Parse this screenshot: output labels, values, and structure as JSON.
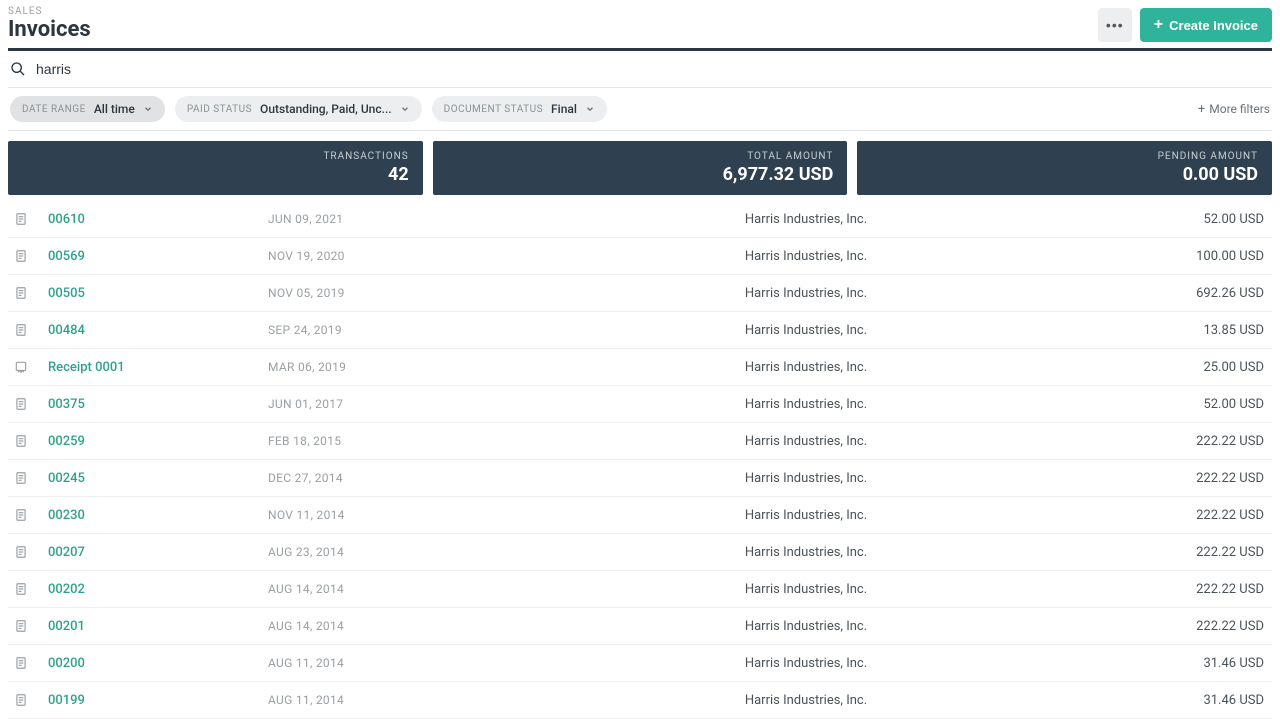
{
  "breadcrumb": "SALES",
  "page_title": "Invoices",
  "create_button": "Create Invoice",
  "search": {
    "value": "harris",
    "placeholder": ""
  },
  "filters": {
    "date_range": {
      "label": "DATE RANGE",
      "value": "All time"
    },
    "paid_status": {
      "label": "PAID STATUS",
      "value": "Outstanding, Paid, Unc..."
    },
    "document_status": {
      "label": "DOCUMENT STATUS",
      "value": "Final"
    },
    "more_filters": "More filters"
  },
  "summary": {
    "transactions": {
      "label": "TRANSACTIONS",
      "value": "42"
    },
    "total_amount": {
      "label": "TOTAL AMOUNT",
      "value": "6,977.32 USD"
    },
    "pending_amount": {
      "label": "PENDING AMOUNT",
      "value": "0.00 USD"
    }
  },
  "invoices": [
    {
      "id": "00610",
      "date": "JUN 09, 2021",
      "company": "Harris Industries, Inc.",
      "amount": "52.00 USD",
      "icon": "doc"
    },
    {
      "id": "00569",
      "date": "NOV 19, 2020",
      "company": "Harris Industries, Inc.",
      "amount": "100.00 USD",
      "icon": "doc"
    },
    {
      "id": "00505",
      "date": "NOV 05, 2019",
      "company": "Harris Industries, Inc.",
      "amount": "692.26 USD",
      "icon": "doc"
    },
    {
      "id": "00484",
      "date": "SEP 24, 2019",
      "company": "Harris Industries, Inc.",
      "amount": "13.85 USD",
      "icon": "doc"
    },
    {
      "id": "Receipt 0001",
      "date": "MAR 06, 2019",
      "company": "Harris Industries, Inc.",
      "amount": "25.00 USD",
      "icon": "receipt"
    },
    {
      "id": "00375",
      "date": "JUN 01, 2017",
      "company": "Harris Industries, Inc.",
      "amount": "52.00 USD",
      "icon": "doc"
    },
    {
      "id": "00259",
      "date": "FEB 18, 2015",
      "company": "Harris Industries, Inc.",
      "amount": "222.22 USD",
      "icon": "doc"
    },
    {
      "id": "00245",
      "date": "DEC 27, 2014",
      "company": "Harris Industries, Inc.",
      "amount": "222.22 USD",
      "icon": "doc"
    },
    {
      "id": "00230",
      "date": "NOV 11, 2014",
      "company": "Harris Industries, Inc.",
      "amount": "222.22 USD",
      "icon": "doc"
    },
    {
      "id": "00207",
      "date": "AUG 23, 2014",
      "company": "Harris Industries, Inc.",
      "amount": "222.22 USD",
      "icon": "doc"
    },
    {
      "id": "00202",
      "date": "AUG 14, 2014",
      "company": "Harris Industries, Inc.",
      "amount": "222.22 USD",
      "icon": "doc"
    },
    {
      "id": "00201",
      "date": "AUG 14, 2014",
      "company": "Harris Industries, Inc.",
      "amount": "222.22 USD",
      "icon": "doc"
    },
    {
      "id": "00200",
      "date": "AUG 11, 2014",
      "company": "Harris Industries, Inc.",
      "amount": "31.46 USD",
      "icon": "doc"
    },
    {
      "id": "00199",
      "date": "AUG 11, 2014",
      "company": "Harris Industries, Inc.",
      "amount": "31.46 USD",
      "icon": "doc"
    }
  ]
}
